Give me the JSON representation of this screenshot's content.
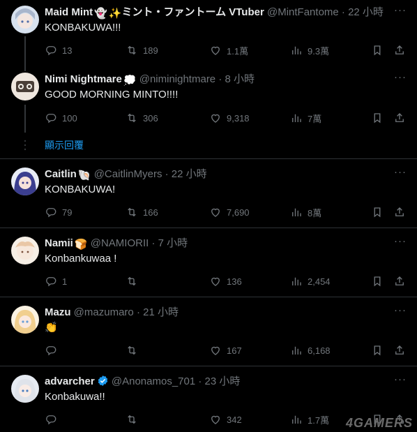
{
  "tweets": [
    {
      "name": "Maid Mint",
      "handle": "@MintFantome",
      "time": "· 22 小時",
      "name_suffix": "ミント・ファントーム VTuber",
      "text": "KONBAKUWA!!!",
      "reply": "13",
      "retweet": "189",
      "like": "1.1萬",
      "views": "9.3萬",
      "avatar_color": "#b9c4d6"
    },
    {
      "name": "Nimi Nightmare",
      "handle": "@niminightmare",
      "time": "· 8 小時",
      "text": "GOOD MORNING MINTO!!!!",
      "reply": "100",
      "retweet": "306",
      "like": "9,318",
      "views": "7萬",
      "avatar_color": "#5a4a3f"
    },
    {
      "name": "Caitlin",
      "handle": "@CaitlinMyers",
      "time": "· 22 小時",
      "text": "KONBAKUWA!",
      "reply": "79",
      "retweet": "166",
      "like": "7,690",
      "views": "8萬",
      "avatar_color": "#5b5aa8"
    },
    {
      "name": "Namii",
      "handle": "@NAMIORII",
      "time": "· 7 小時",
      "text": "Konbankuwaa !",
      "reply": "1",
      "retweet": "",
      "like": "136",
      "views": "2,454",
      "avatar_color": "#e8d8c8"
    },
    {
      "name": "Mazu",
      "handle": "@mazumaro",
      "time": "· 21 小時",
      "text": "👏",
      "reply": "",
      "retweet": "",
      "like": "167",
      "views": "6,168",
      "avatar_color": "#f0d7a8"
    },
    {
      "name": "advarcher",
      "handle": "@Anonamos_701",
      "time": "· 23 小時",
      "text": "Konbakuwa!!",
      "reply": "",
      "retweet": "",
      "like": "342",
      "views": "1.7萬",
      "avatar_color": "#cfd6e0"
    }
  ],
  "show_replies": "顯示回覆",
  "more_glyph": "···",
  "watermark": "4GAMERS",
  "colors": {
    "accent": "#1d9bf0",
    "muted": "#71767b",
    "text": "#e7e9ea",
    "border": "#2f3336"
  }
}
